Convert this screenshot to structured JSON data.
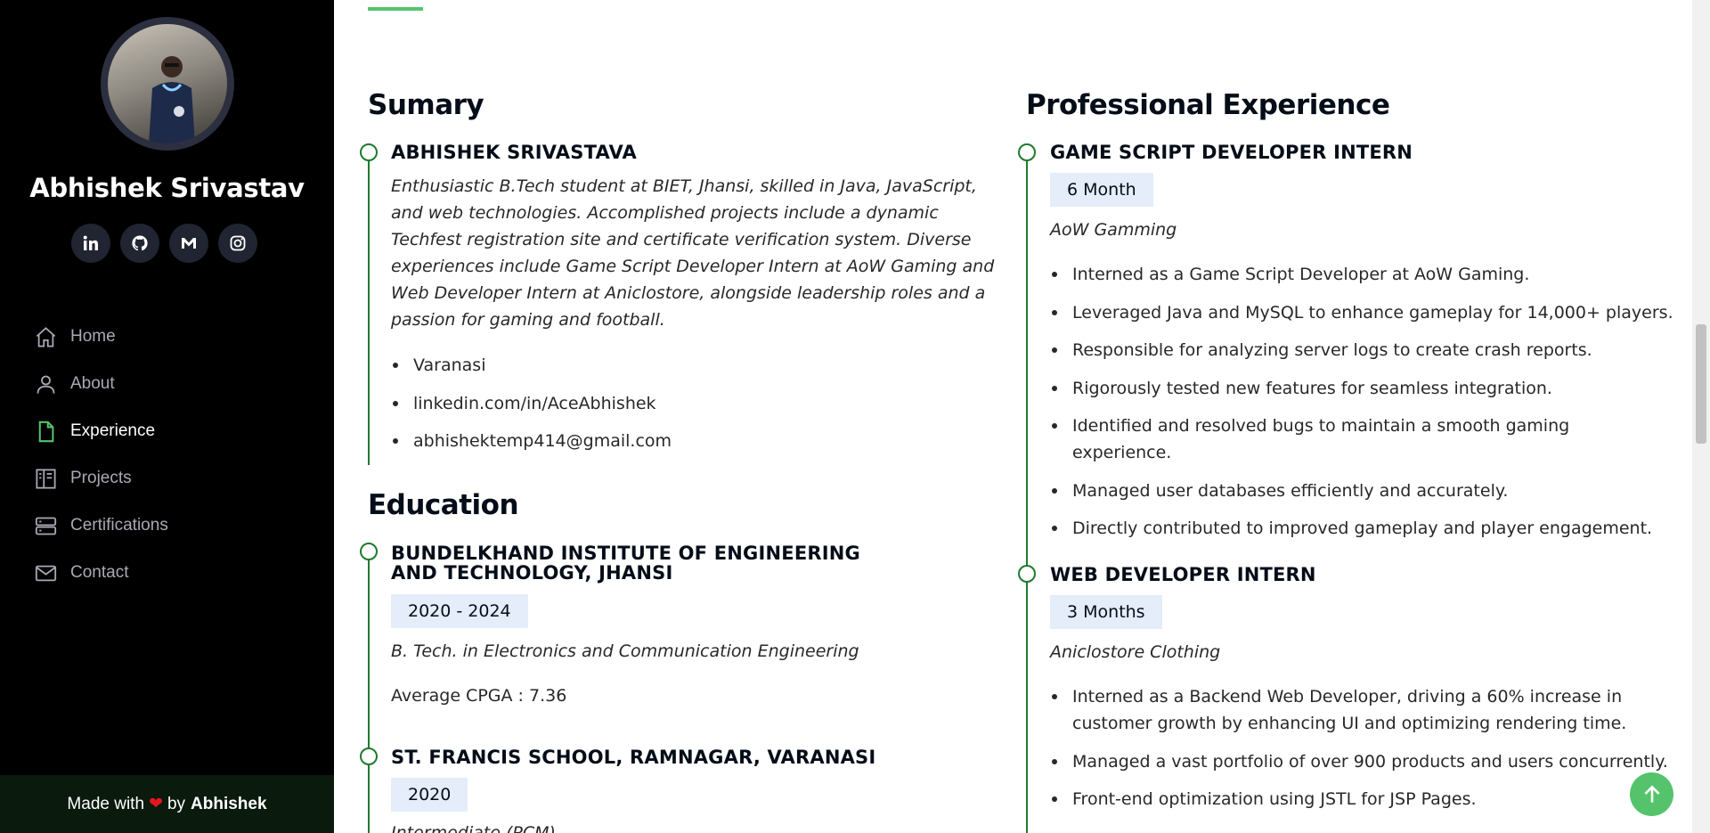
{
  "profile": {
    "name": "Abhishek Srivastav",
    "socials": [
      {
        "icon": "linkedin-icon"
      },
      {
        "icon": "github-icon"
      },
      {
        "icon": "gmail-icon"
      },
      {
        "icon": "instagram-icon"
      }
    ]
  },
  "nav": {
    "items": [
      {
        "label": "Home",
        "icon": "home-icon",
        "active": false
      },
      {
        "label": "About",
        "icon": "person-icon",
        "active": false
      },
      {
        "label": "Experience",
        "icon": "file-icon",
        "active": true
      },
      {
        "label": "Projects",
        "icon": "layout-icon",
        "active": false
      },
      {
        "label": "Certifications",
        "icon": "server-icon",
        "active": false
      },
      {
        "label": "Contact",
        "icon": "envelope-icon",
        "active": false
      }
    ]
  },
  "footer": {
    "made_with": "Made with",
    "by": "by",
    "author": "Abhishek"
  },
  "summary": {
    "title": "Sumary",
    "name": "ABHISHEK SRIVASTAVA",
    "description": "Enthusiastic B.Tech student at BIET, Jhansi, skilled in Java, JavaScript, and web technologies. Accomplished projects include a dynamic Techfest registration site and certificate verification system. Diverse experiences include Game Script Developer Intern at AoW Gaming and Web Developer Intern at Aniclostore, alongside leadership roles and a passion for gaming and football.",
    "contacts": [
      "Varanasi",
      "linkedin.com/in/AceAbhishek",
      "abhishektemp414@gmail.com"
    ]
  },
  "education": {
    "title": "Education",
    "items": [
      {
        "school": "BUNDELKHAND INSTITUTE OF ENGINEERING AND TECHNOLOGY, JHANSI",
        "years": "2020 - 2024",
        "degree": "B. Tech. in Electronics and Communication Engineering",
        "score": "Average CPGA : 7.36"
      },
      {
        "school": "ST. FRANCIS SCHOOL, RAMNAGAR, VARANASI",
        "years": "2020",
        "degree": "Intermediate (PCM)"
      }
    ]
  },
  "experience": {
    "title": "Professional Experience",
    "items": [
      {
        "role": "GAME SCRIPT DEVELOPER INTERN",
        "duration": "6 Month",
        "company": "AoW Gamming",
        "points": [
          "Interned as a Game Script Developer at AoW Gaming.",
          "Leveraged Java and MySQL to enhance gameplay for 14,000+ players.",
          "Responsible for analyzing server logs to create crash reports.",
          "Rigorously tested new features for seamless integration.",
          "Identified and resolved bugs to maintain a smooth gaming experience.",
          "Managed user databases efficiently and accurately.",
          "Directly contributed to improved gameplay and player engagement."
        ]
      },
      {
        "role": "WEB DEVELOPER INTERN",
        "duration": "3 Months",
        "company": "Aniclostore Clothing",
        "points": [
          "Interned as a Backend Web Developer, driving a 60% increase in customer growth by enhancing UI and optimizing rendering time.",
          "Managed a vast portfolio of over 900 products and users concurrently.",
          "Front-end optimization using JSTL for JSP Pages."
        ]
      }
    ]
  },
  "colors": {
    "accent": "#55c36c",
    "timeline": "#1f7a2e",
    "badge_bg": "#e4edf9",
    "sidebar_bg": "#000000"
  }
}
